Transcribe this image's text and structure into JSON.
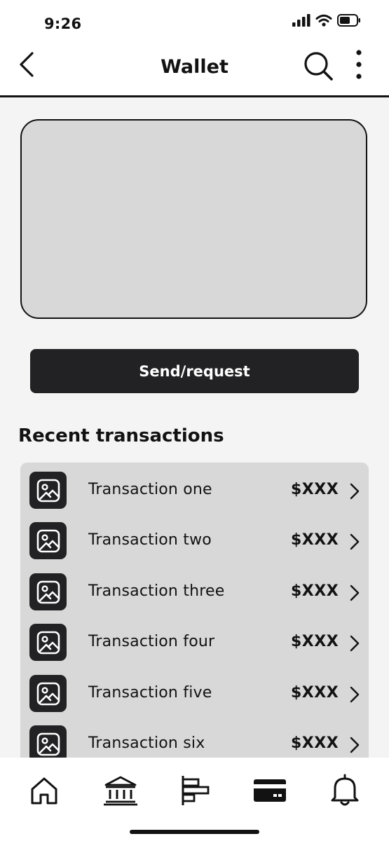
{
  "status_bar": {
    "time": "9:26"
  },
  "header": {
    "title": "Wallet"
  },
  "send_button": {
    "label": "Send/request"
  },
  "transactions": {
    "section_title": "Recent transactions",
    "items": [
      {
        "label": "Transaction one",
        "amount": "$XXX"
      },
      {
        "label": "Transaction two",
        "amount": "$XXX"
      },
      {
        "label": "Transaction three",
        "amount": "$XXX"
      },
      {
        "label": "Transaction four",
        "amount": "$XXX"
      },
      {
        "label": "Transaction five",
        "amount": "$XXX"
      },
      {
        "label": "Transaction six",
        "amount": "$XXX"
      }
    ]
  },
  "bottom_nav": {
    "items": [
      {
        "icon": "home-icon"
      },
      {
        "icon": "bank-icon"
      },
      {
        "icon": "bar-chart-icon"
      },
      {
        "icon": "card-icon"
      },
      {
        "icon": "bell-icon"
      }
    ]
  },
  "colors": {
    "background": "#f4f4f4",
    "surface": "#ffffff",
    "placeholder": "#d8d8d8",
    "dark": "#222224",
    "text": "#121212"
  }
}
